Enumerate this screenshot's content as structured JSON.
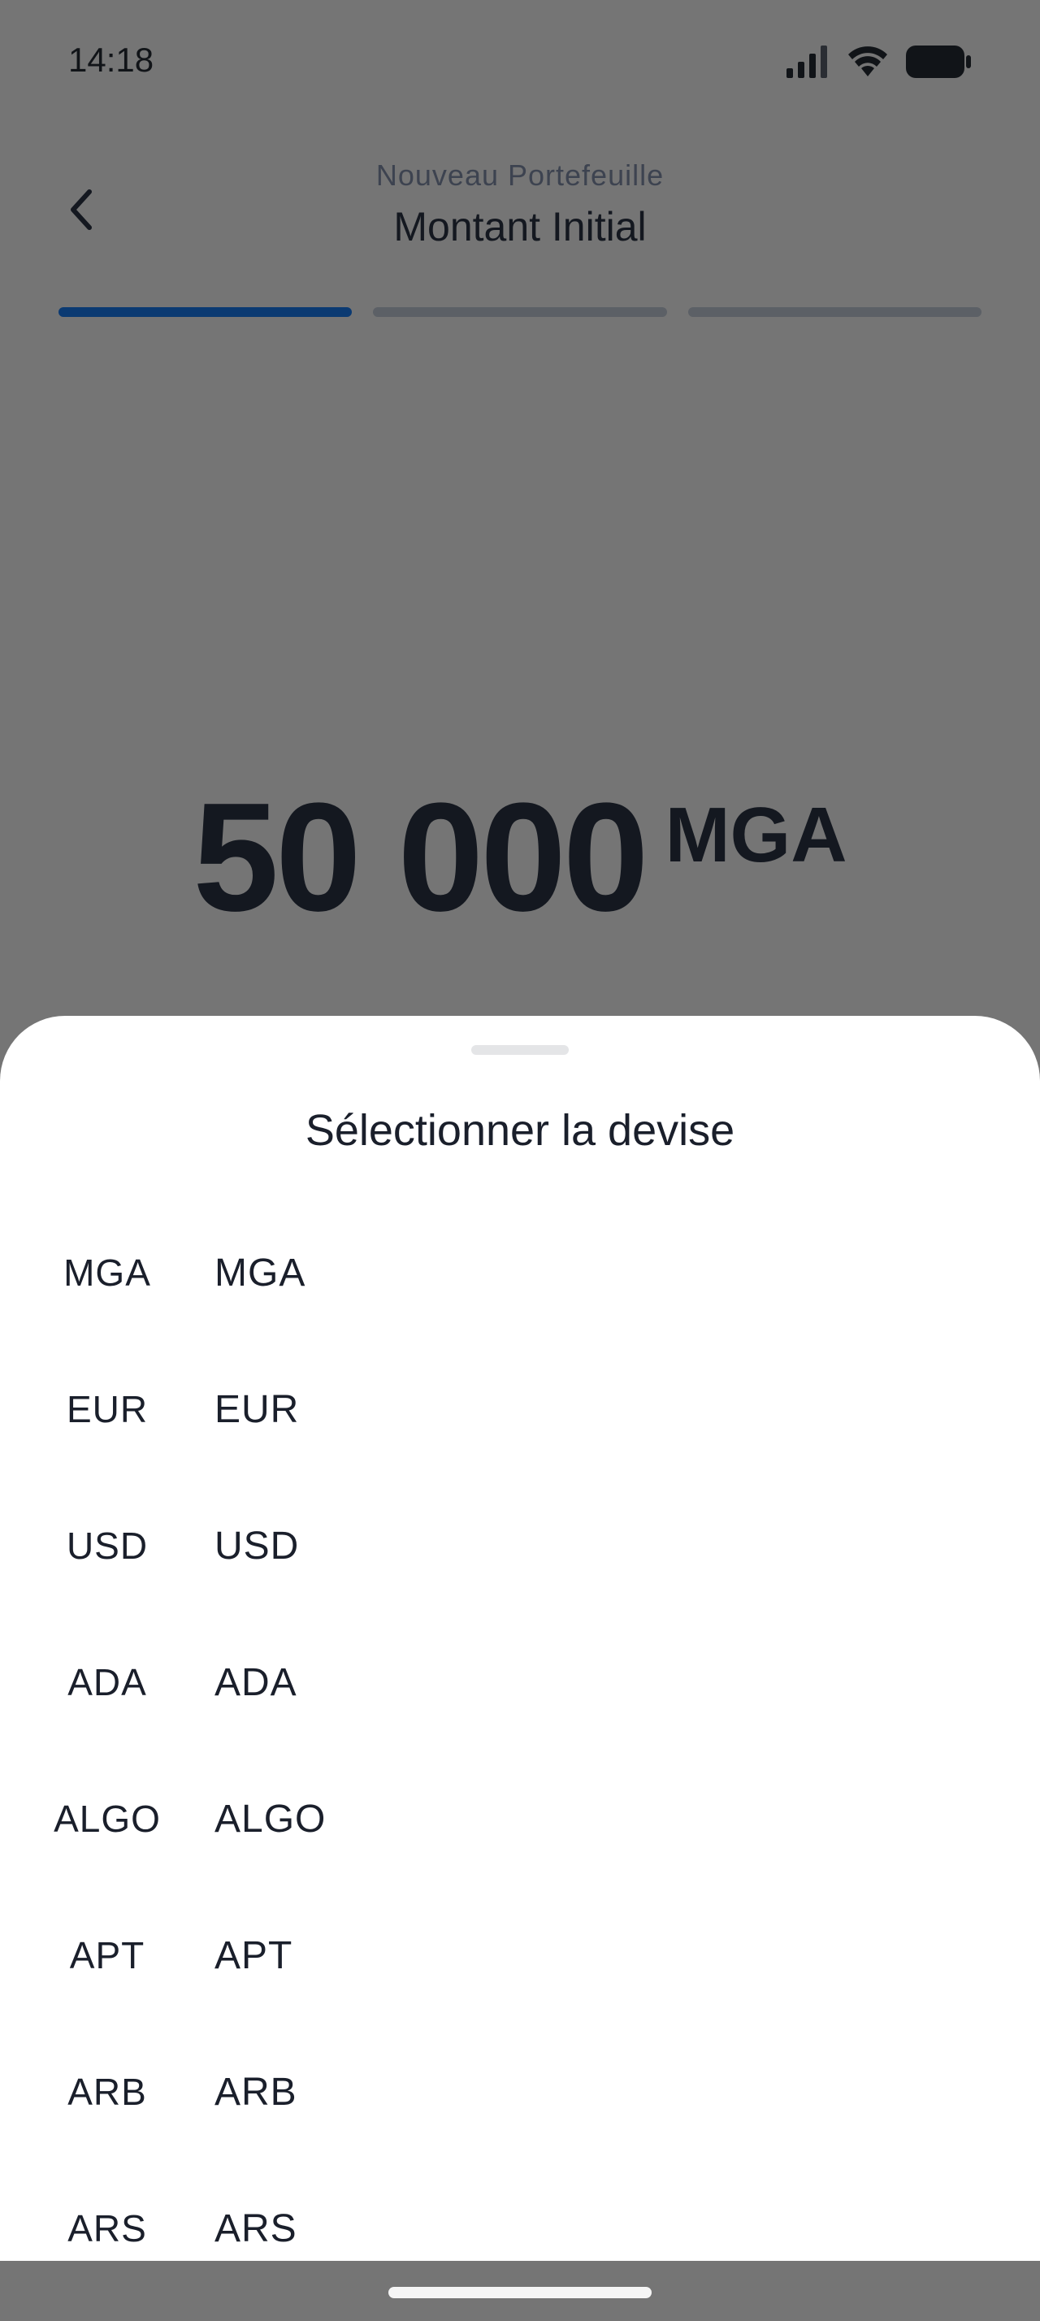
{
  "status_bar": {
    "time": "14:18"
  },
  "header": {
    "subtitle": "Nouveau Portefeuille",
    "title": "Montant Initial",
    "back_icon": "chevron-left-icon"
  },
  "progress": {
    "total_steps": 3,
    "current_step": 1
  },
  "amount": {
    "value": "50 000",
    "currency": "MGA"
  },
  "sheet": {
    "title": "Sélectionner la devise",
    "currencies": [
      {
        "code": "MGA",
        "name": "MGA"
      },
      {
        "code": "EUR",
        "name": "EUR"
      },
      {
        "code": "USD",
        "name": "USD"
      },
      {
        "code": "ADA",
        "name": "ADA"
      },
      {
        "code": "ALGO",
        "name": "ALGO"
      },
      {
        "code": "APT",
        "name": "APT"
      },
      {
        "code": "ARB",
        "name": "ARB"
      },
      {
        "code": "ARS",
        "name": "ARS"
      }
    ]
  },
  "colors": {
    "overlay": "#757575",
    "progress_active": "#0b3a72",
    "progress_inactive": "#5c6066",
    "sheet_background": "#ffffff",
    "text_primary": "#1a1f2b"
  }
}
